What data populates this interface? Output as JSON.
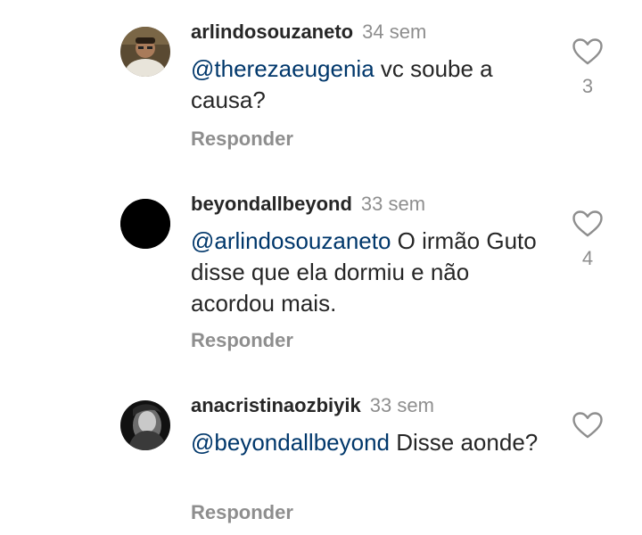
{
  "comments": [
    {
      "username": "arlindosouzaneto",
      "time": "34 sem",
      "mention": "@therezaeugenia",
      "text": " vc soube a causa?",
      "reply_label": "Responder",
      "likes": "3"
    },
    {
      "username": "beyondallbeyond",
      "time": "33 sem",
      "mention": "@arlindosouzaneto",
      "text": " O irmão Guto disse que ela dormiu e não acordou mais.",
      "reply_label": "Responder",
      "likes": "4"
    },
    {
      "username": "anacristinaozbiyik",
      "time": "33 sem",
      "mention": "@beyondallbeyond",
      "text": " Disse aonde?",
      "reply_label": "Responder",
      "likes": ""
    }
  ],
  "icons": {
    "like": "heart-outline-icon"
  },
  "colors": {
    "text": "#262626",
    "secondary": "#8e8e8e",
    "mention": "#00376b"
  }
}
